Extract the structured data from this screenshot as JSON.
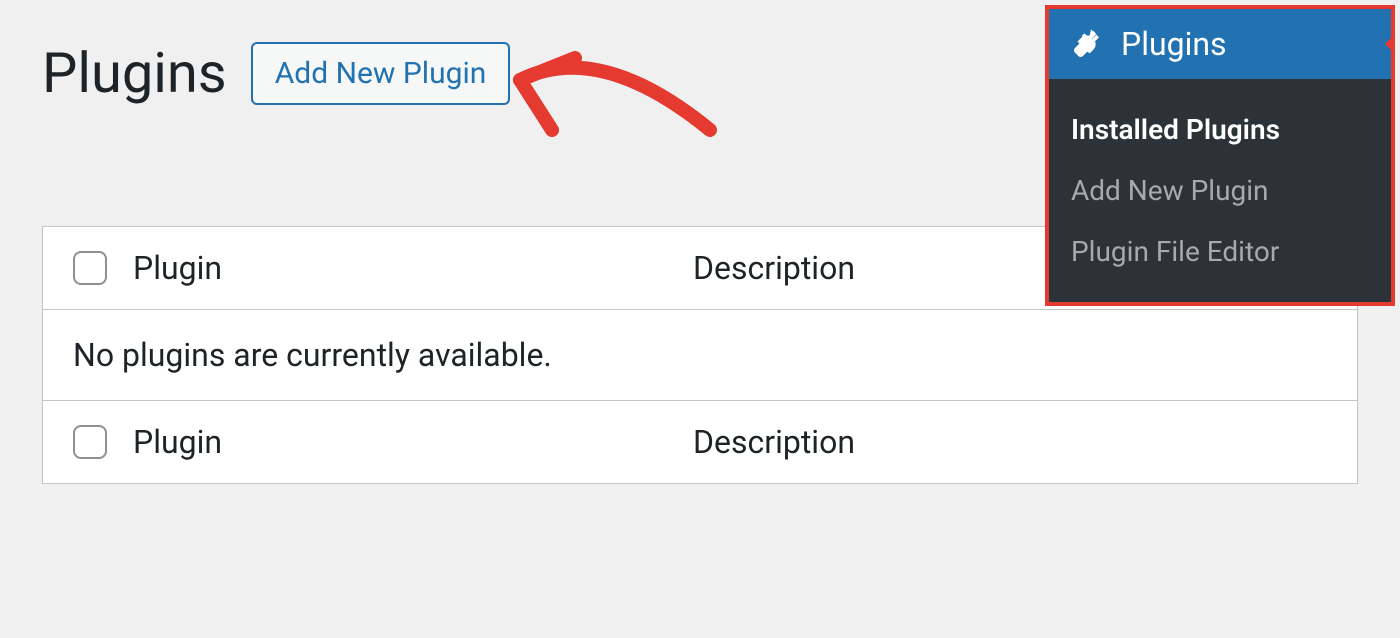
{
  "header": {
    "title": "Plugins",
    "add_button": "Add New Plugin"
  },
  "table": {
    "columns": {
      "plugin": "Plugin",
      "description": "Description"
    },
    "empty_message": "No plugins are currently available."
  },
  "sidebar": {
    "menu_title": "Plugins",
    "items": [
      {
        "label": "Installed Plugins",
        "active": true
      },
      {
        "label": "Add New Plugin",
        "active": false
      },
      {
        "label": "Plugin File Editor",
        "active": false
      }
    ]
  }
}
